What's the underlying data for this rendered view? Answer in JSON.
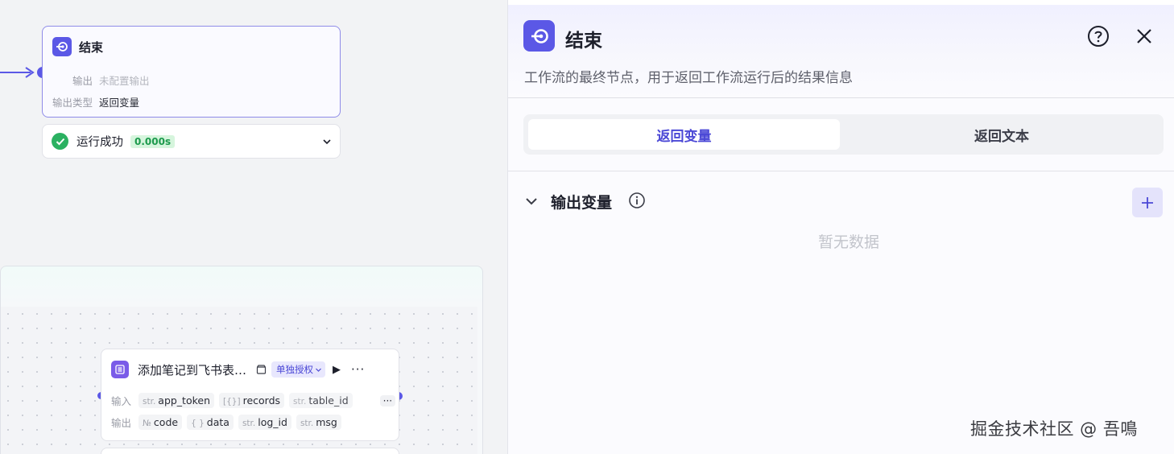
{
  "canvas": {
    "end_node": {
      "title": "结束",
      "rows": [
        {
          "key": "输出",
          "value": "未配置输出"
        },
        {
          "key": "输出类型",
          "value": "返回变量"
        }
      ],
      "icon": "end-node-icon"
    },
    "run_status": {
      "label": "运行成功",
      "duration": "0.000s",
      "icon": "check-circle-icon",
      "status_color": "#2bb161"
    },
    "plugin_node": {
      "title": "添加笔记到飞书表…",
      "auth_label": "单独授权",
      "icon": "table-list-icon",
      "inputs_label": "输入",
      "inputs": [
        {
          "type": "str.",
          "name": "app_token"
        },
        {
          "type": "[{}]",
          "name": "records"
        },
        {
          "type": "str.",
          "name": "table_id"
        }
      ],
      "inputs_more": "···",
      "outputs_label": "输出",
      "outputs": [
        {
          "type": "№",
          "name": "code"
        },
        {
          "type": "{ }",
          "name": "data"
        },
        {
          "type": "str.",
          "name": "log_id"
        },
        {
          "type": "str.",
          "name": "msg"
        }
      ]
    }
  },
  "panel": {
    "title": "结束",
    "description": "工作流的最终节点，用于返回工作流运行后的结果信息",
    "tabs": [
      {
        "label": "返回变量",
        "selected": true
      },
      {
        "label": "返回文本",
        "selected": false
      }
    ],
    "section_title": "输出变量",
    "empty_text": "暂无数据",
    "accent": "#5b58e6"
  },
  "watermark": "掘金技术社区 @ 吾鳴"
}
